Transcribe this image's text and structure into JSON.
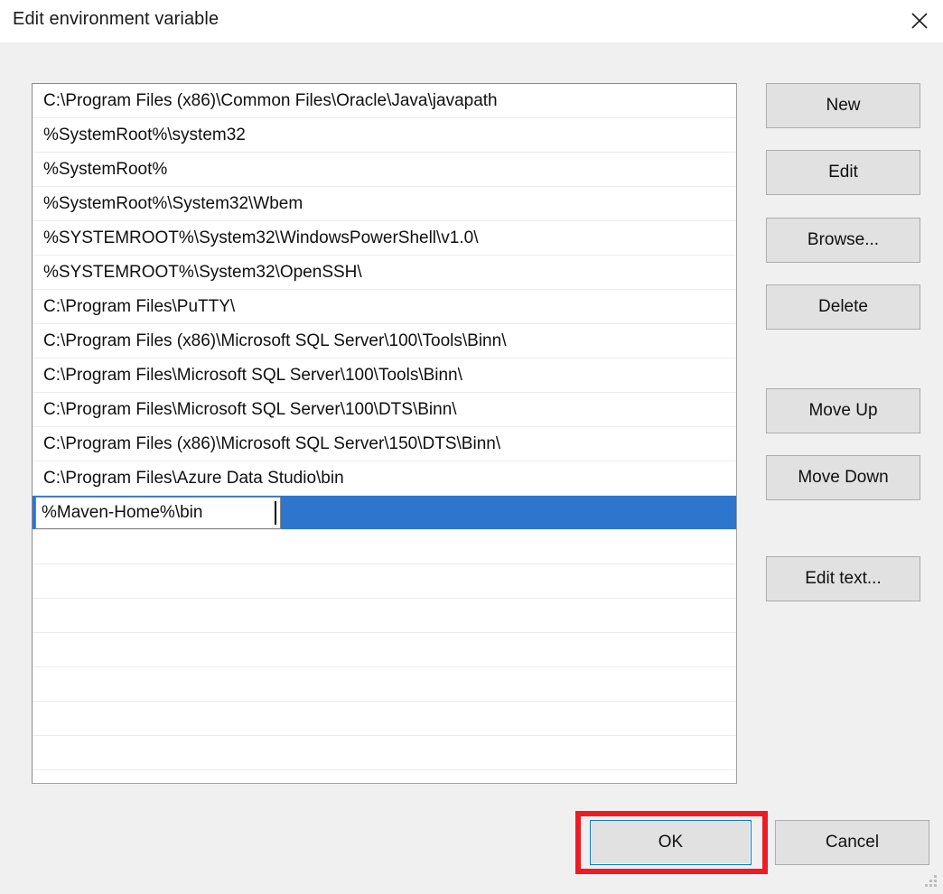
{
  "window": {
    "title": "Edit environment variable",
    "close_icon": "close-icon",
    "resize_grip_icon": "resize-grip-icon"
  },
  "colors": {
    "selection_blue": "#2e75ce",
    "focus_blue": "#0078d7",
    "annotation_red": "#ed1c24",
    "button_face": "#e1e1e1",
    "dialog_background": "#f0f0f0"
  },
  "path_list": {
    "entries": [
      "C:\\Program Files (x86)\\Common Files\\Oracle\\Java\\javapath",
      "%SystemRoot%\\system32",
      "%SystemRoot%",
      "%SystemRoot%\\System32\\Wbem",
      "%SYSTEMROOT%\\System32\\WindowsPowerShell\\v1.0\\",
      "%SYSTEMROOT%\\System32\\OpenSSH\\",
      "C:\\Program Files\\PuTTY\\",
      "C:\\Program Files (x86)\\Microsoft SQL Server\\100\\Tools\\Binn\\",
      "C:\\Program Files\\Microsoft SQL Server\\100\\Tools\\Binn\\",
      "C:\\Program Files\\Microsoft SQL Server\\100\\DTS\\Binn\\",
      "C:\\Program Files (x86)\\Microsoft SQL Server\\150\\DTS\\Binn\\",
      "C:\\Program Files\\Azure Data Studio\\bin"
    ],
    "editing_row": {
      "value": "%Maven-Home%\\bin",
      "selected": true,
      "caret_visible": true
    },
    "empty_row_count": 8
  },
  "side_buttons": {
    "new": "New",
    "edit": "Edit",
    "browse": "Browse...",
    "delete": "Delete",
    "move_up": "Move Up",
    "move_down": "Move Down",
    "edit_text": "Edit text..."
  },
  "bottom_buttons": {
    "ok": "OK",
    "cancel": "Cancel"
  }
}
